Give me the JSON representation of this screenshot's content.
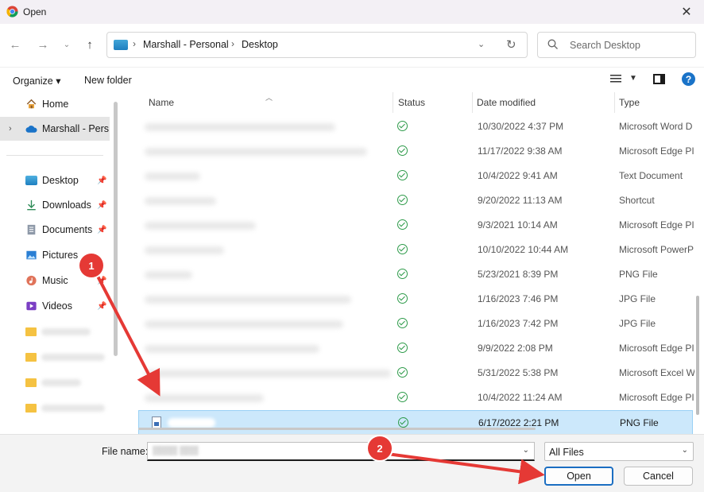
{
  "window": {
    "title": "Open",
    "close_glyph": "✕"
  },
  "address": {
    "crumbs": [
      "Marshall - Personal",
      "Desktop"
    ],
    "separator": "›"
  },
  "search": {
    "placeholder": "Search Desktop"
  },
  "toolbar": {
    "organize": "Organize ▾",
    "new_folder": "New folder",
    "help": "?"
  },
  "sidebar": {
    "items": [
      {
        "label": "Home",
        "icon": "home-icon"
      },
      {
        "label": "Marshall - Personal",
        "icon": "cloud-icon",
        "selected": true
      },
      {
        "label": "Desktop",
        "icon": "desktop-icon",
        "pinned": true
      },
      {
        "label": "Downloads",
        "icon": "download-icon",
        "pinned": true
      },
      {
        "label": "Documents",
        "icon": "document-icon",
        "pinned": true
      },
      {
        "label": "Pictures",
        "icon": "pictures-icon",
        "pinned": true
      },
      {
        "label": "Music",
        "icon": "music-icon",
        "pinned": true
      },
      {
        "label": "Videos",
        "icon": "videos-icon",
        "pinned": true
      }
    ]
  },
  "columns": {
    "name": "Name",
    "status": "Status",
    "date": "Date modified",
    "type": "Type"
  },
  "files": [
    {
      "date": "10/30/2022 4:37 PM",
      "type": "Microsoft Word D"
    },
    {
      "date": "11/17/2022 9:38 AM",
      "type": "Microsoft Edge PI"
    },
    {
      "date": "10/4/2022 9:41 AM",
      "type": "Text Document"
    },
    {
      "date": "9/20/2022 11:13 AM",
      "type": "Shortcut"
    },
    {
      "date": "9/3/2021 10:14 AM",
      "type": "Microsoft Edge PI"
    },
    {
      "date": "10/10/2022 10:44 AM",
      "type": "Microsoft PowerP"
    },
    {
      "date": "5/23/2021 8:39 PM",
      "type": "PNG File"
    },
    {
      "date": "1/16/2023 7:46 PM",
      "type": "JPG File"
    },
    {
      "date": "1/16/2023 7:42 PM",
      "type": "JPG File"
    },
    {
      "date": "9/9/2022 2:08 PM",
      "type": "Microsoft Edge PI"
    },
    {
      "date": "5/31/2022 5:38 PM",
      "type": "Microsoft Excel W"
    },
    {
      "date": "10/4/2022 11:24 AM",
      "type": "Microsoft Edge PI"
    },
    {
      "date": "6/17/2022 2:21 PM",
      "type": "PNG File",
      "selected": true
    }
  ],
  "footer": {
    "file_name_label": "File name:",
    "file_type": "All Files",
    "open_label": "Open",
    "cancel_label": "Cancel"
  },
  "annotations": [
    "1",
    "2"
  ],
  "colors": {
    "accent": "#1b6ec2",
    "annotation": "#e53935",
    "selection": "#cce8fb",
    "status_ok": "#2e9b4a"
  }
}
